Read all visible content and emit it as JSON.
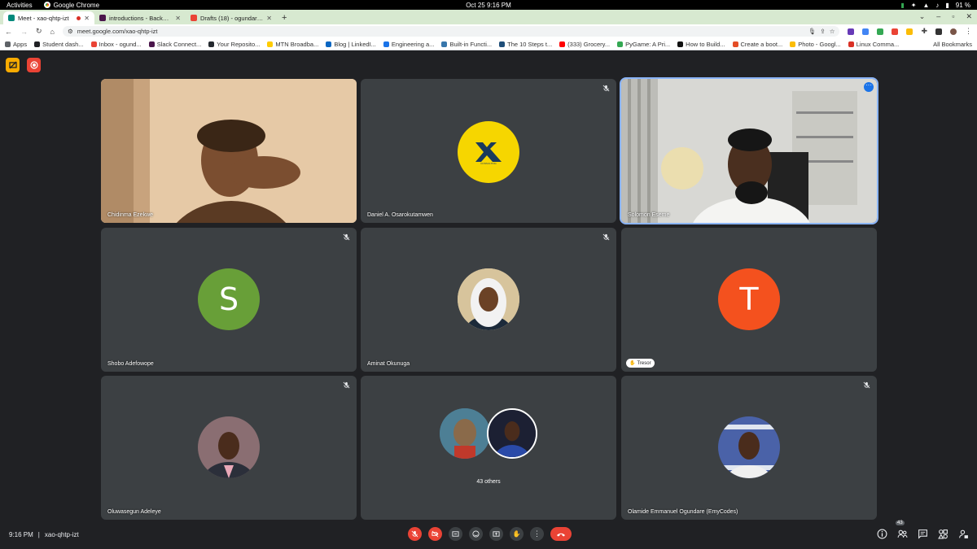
{
  "system": {
    "activities": "Activities",
    "app": "Google Chrome",
    "clock": "Oct 25  9:16 PM",
    "battery": "91 %"
  },
  "tabs": [
    {
      "label": "Meet - xao-qhtp-izt",
      "color": "#00897b"
    },
    {
      "label": "introductions - Backend",
      "color": "#4a154b"
    },
    {
      "label": "Drafts (18) - ogundareoluw",
      "color": "#ea4335"
    }
  ],
  "address": {
    "url": "meet.google.com/xao-qhtp-izt"
  },
  "bookmarks": {
    "items": [
      {
        "label": "Apps",
        "color": "#5f6368"
      },
      {
        "label": "Student dash...",
        "color": "#202124"
      },
      {
        "label": "Inbox - ogund...",
        "color": "#ea4335"
      },
      {
        "label": "Slack Connect...",
        "color": "#4a154b"
      },
      {
        "label": "Your Reposito...",
        "color": "#24292f"
      },
      {
        "label": "MTN Broadba...",
        "color": "#ffcc00"
      },
      {
        "label": "Blog | LinkedI...",
        "color": "#0a66c2"
      },
      {
        "label": "Engineering a...",
        "color": "#1a73e8"
      },
      {
        "label": "Built-in Functi...",
        "color": "#3776ab"
      },
      {
        "label": "The 10 Steps t...",
        "color": "#1f4e79"
      },
      {
        "label": "(333) Grocery...",
        "color": "#ff0000"
      },
      {
        "label": "PyGame: A Pri...",
        "color": "#34a853"
      },
      {
        "label": "How to Build...",
        "color": "#111111"
      },
      {
        "label": "Create a boot...",
        "color": "#e44d26"
      },
      {
        "label": "Photo - Googl...",
        "color": "#fbbc05"
      },
      {
        "label": "Linux Comma...",
        "color": "#d93025"
      }
    ],
    "all": "All Bookmarks"
  },
  "participants": [
    {
      "name": "Chidinma Ezekwe",
      "type": "video",
      "muted": false
    },
    {
      "name": "Daniel A. Osarokutamwen",
      "type": "logo",
      "muted": true
    },
    {
      "name": "Solomon Eseme",
      "type": "video",
      "muted": false
    },
    {
      "name": "Shobo Adefowope",
      "type": "initial",
      "initial": "S",
      "color": "#689f38",
      "muted": true
    },
    {
      "name": "Aminat Okunuga",
      "type": "photo",
      "muted": true
    },
    {
      "name": "Tresor",
      "type": "initial",
      "initial": "T",
      "color": "#f4511e",
      "muted": false
    },
    {
      "name": "Oluwasegun Adeleye",
      "type": "photo",
      "muted": true
    },
    {
      "name": "43 others",
      "type": "others",
      "muted": false
    },
    {
      "name": "Olamide Emmanuel Ogundare (EmyCodes)",
      "type": "photo",
      "muted": true
    }
  ],
  "meeting": {
    "time": "9:16 PM",
    "code": "xao-qhtp-izt",
    "participant_count": "43"
  },
  "colors": {
    "background": "#202124",
    "tile": "#3c4043",
    "accent": "#8ab4f8",
    "danger": "#ea4335"
  }
}
